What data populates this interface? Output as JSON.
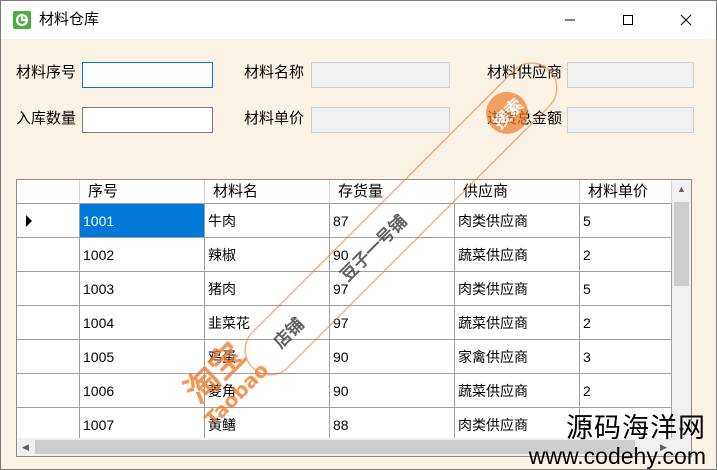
{
  "window": {
    "title": "材料仓库"
  },
  "form": {
    "material_no_label": "材料序号",
    "material_no_value": "",
    "quantity_label": "入库数量",
    "quantity_value": "",
    "material_name_label": "材料名称",
    "material_name_value": "",
    "unit_price_label": "材料单价",
    "unit_price_value": "",
    "supplier_label": "材料供应商",
    "supplier_value": "",
    "total_amount_label": "进货总金额",
    "total_amount_value": ""
  },
  "grid": {
    "headers": [
      "序号",
      "材料名",
      "存货量",
      "供应商",
      "材料单价"
    ],
    "rows": [
      [
        "1001",
        "牛肉",
        "87",
        "肉类供应商",
        "5"
      ],
      [
        "1002",
        "辣椒",
        "90",
        "蔬菜供应商",
        "2"
      ],
      [
        "1003",
        "猪肉",
        "97",
        "肉类供应商",
        "5"
      ],
      [
        "1004",
        "韭菜花",
        "97",
        "蔬菜供应商",
        "2"
      ],
      [
        "1005",
        "鸡蛋",
        "90",
        "家禽供应商",
        "3"
      ],
      [
        "1006",
        "菱角",
        "90",
        "蔬菜供应商",
        "2"
      ],
      [
        "1007",
        "黄鳝",
        "88",
        "肉类供应商",
        "3"
      ]
    ],
    "selected_row": 0
  },
  "watermark": {
    "search_text": "搜索",
    "shop_text": "店铺",
    "shop_name": "豆子一号铺",
    "brand_cn": "淘宝",
    "brand_en": "Taobao",
    "site_name": "源码海洋网",
    "site_url": "www.codehy.com"
  },
  "colors": {
    "selection": "#0078d7",
    "window_bg": "#faf3e5",
    "watermark_orange": "#f07a2a"
  }
}
